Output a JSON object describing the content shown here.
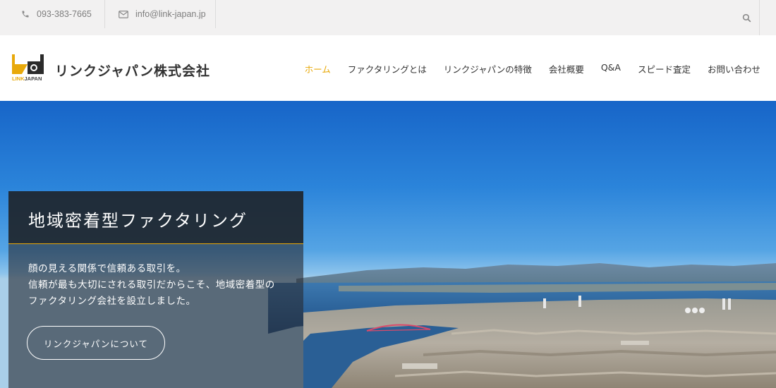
{
  "topbar": {
    "phone": "093-383-7665",
    "email": "info@link-japan.jp"
  },
  "header": {
    "logo_text_link": "LINK",
    "logo_text_japan": "JAPAN",
    "company_name": "リンクジャパン株式会社",
    "nav": [
      {
        "label": "ホーム",
        "active": true
      },
      {
        "label": "ファクタリングとは",
        "active": false
      },
      {
        "label": "リンクジャパンの特徴",
        "active": false
      },
      {
        "label": "会社概要",
        "active": false
      },
      {
        "label": "Q&A",
        "active": false
      },
      {
        "label": "スピード査定",
        "active": false
      },
      {
        "label": "お問い合わせ",
        "active": false
      }
    ]
  },
  "hero": {
    "title": "地域密着型ファクタリング",
    "body_lines": [
      "顔の見える関係で信頼ある取引を。",
      "信頼が最も大切にされる取引だからこそ、地域密着型の",
      "ファクタリング会社を設立しました。"
    ],
    "button_label": "リンクジャパンについて"
  },
  "colors": {
    "accent": "#e8a90a",
    "topbar_bg": "#f2f1f1",
    "text_dark": "#333333"
  },
  "icons": [
    "phone-icon",
    "mail-icon",
    "search-icon"
  ]
}
